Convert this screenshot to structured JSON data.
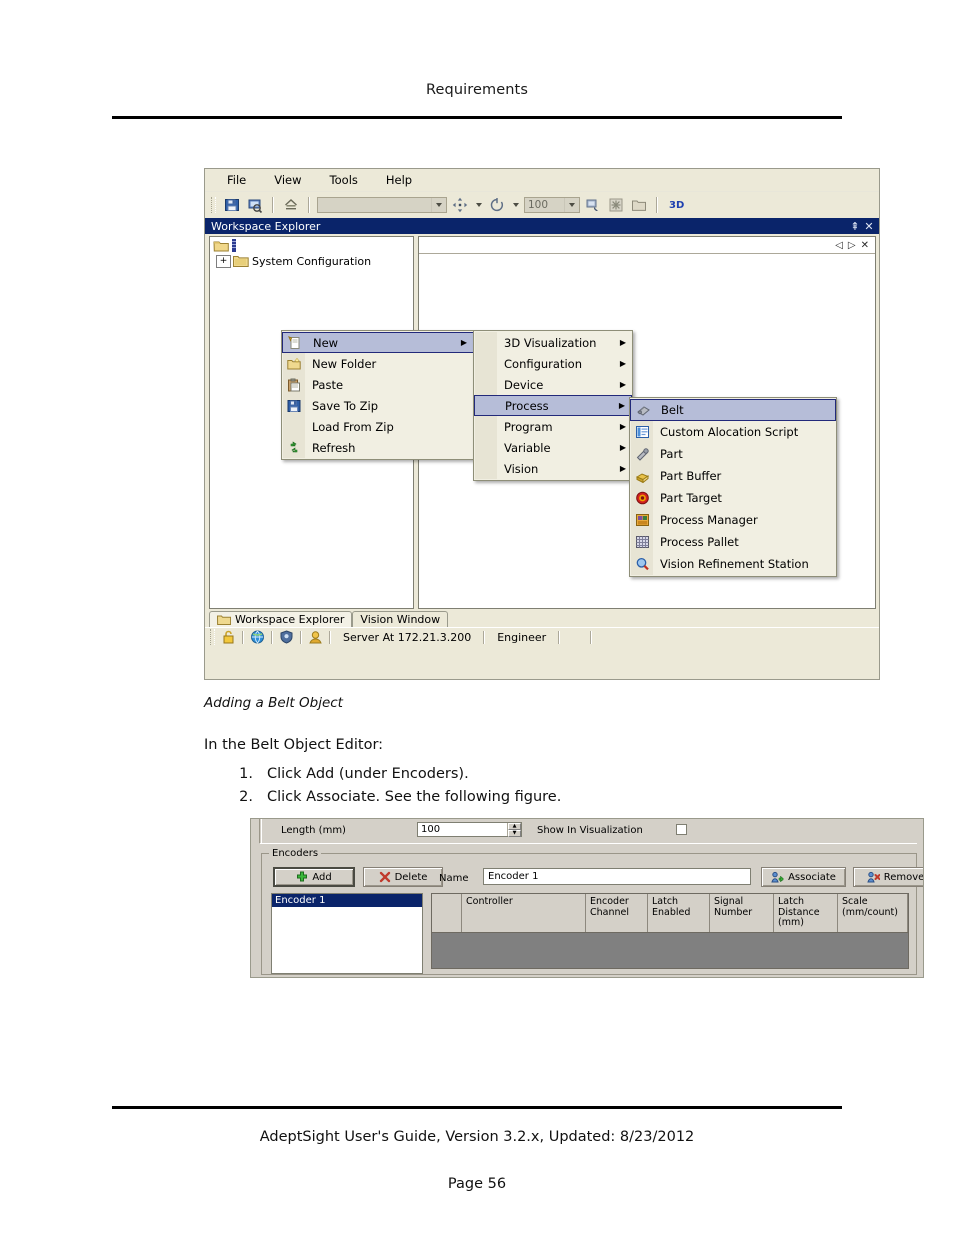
{
  "document": {
    "header_title": "Requirements",
    "footer_line": "AdeptSight User's Guide,  Version 3.2.x, Updated: 8/23/2012",
    "footer_page": "Page 56",
    "figure1_caption": "Adding a Belt Object",
    "intro": "In the Belt Object Editor:",
    "steps": [
      {
        "num": "1.",
        "text": "Click Add (under Encoders)."
      },
      {
        "num": "2.",
        "text": "Click Associate. See the following figure."
      }
    ]
  },
  "app": {
    "menubar": [
      "File",
      "View",
      "Tools",
      "Help"
    ],
    "toolbar": {
      "combo_value": "",
      "zoom_value": "100",
      "button_3d": "3D",
      "icons": [
        "save-icon",
        "print-preview-icon",
        "home-icon",
        "move-tool-icon",
        "rotate-tool-icon",
        "calibrate-icon",
        "snowflake-icon",
        "folder-icon"
      ]
    },
    "panel": {
      "title": "Workspace Explorer",
      "pin_icon": "pin-icon",
      "close_icon": "close-icon"
    },
    "doc_area": {
      "prev_icon": "chevron-left-icon",
      "next_icon": "chevron-right-icon",
      "close_icon": "close-icon"
    },
    "tree": {
      "root_label": "",
      "items": [
        {
          "label": "System Configuration",
          "expander": "+"
        }
      ]
    },
    "bottom_tabs": [
      {
        "label": "Workspace Explorer",
        "selected": true
      },
      {
        "label": "Vision Window",
        "selected": false
      }
    ],
    "statusbar": {
      "server": "Server At 172.21.3.200",
      "user": "Engineer",
      "icons": [
        "lock-icon",
        "globe-icon",
        "shield-icon",
        "user-icon"
      ]
    },
    "context_menu": {
      "items": [
        {
          "label": "New",
          "icon": "new-document-icon",
          "submenu": true,
          "selected": true
        },
        {
          "label": "New Folder",
          "icon": "new-folder-icon",
          "submenu": false,
          "selected": false
        },
        {
          "label": "Paste",
          "icon": "paste-icon",
          "submenu": false,
          "selected": false
        },
        {
          "label": "Save To Zip",
          "icon": "save-icon",
          "submenu": false,
          "selected": false
        },
        {
          "label": "Load From Zip",
          "icon": "",
          "submenu": false,
          "selected": false
        },
        {
          "label": "Refresh",
          "icon": "refresh-icon",
          "submenu": false,
          "selected": false
        }
      ]
    },
    "new_submenu": {
      "items": [
        {
          "label": "3D Visualization",
          "submenu": true,
          "selected": false
        },
        {
          "label": "Configuration",
          "submenu": true,
          "selected": false
        },
        {
          "label": "Device",
          "submenu": true,
          "selected": false
        },
        {
          "label": "Process",
          "submenu": true,
          "selected": true
        },
        {
          "label": "Program",
          "submenu": true,
          "selected": false
        },
        {
          "label": "Variable",
          "submenu": true,
          "selected": false
        },
        {
          "label": "Vision",
          "submenu": true,
          "selected": false
        }
      ]
    },
    "process_submenu": {
      "items": [
        {
          "label": "Belt",
          "icon": "belt-icon",
          "selected": true
        },
        {
          "label": "Custom Alocation Script",
          "icon": "script-icon",
          "selected": false
        },
        {
          "label": "Part",
          "icon": "part-icon",
          "selected": false
        },
        {
          "label": "Part Buffer",
          "icon": "part-buffer-icon",
          "selected": false
        },
        {
          "label": "Part Target",
          "icon": "part-target-icon",
          "selected": false
        },
        {
          "label": "Process Manager",
          "icon": "process-manager-icon",
          "selected": false
        },
        {
          "label": "Process Pallet",
          "icon": "process-pallet-icon",
          "selected": false
        },
        {
          "label": "Vision Refinement Station",
          "icon": "magnifier-icon",
          "selected": false
        }
      ]
    }
  },
  "belt_editor": {
    "length_label": "Length (mm)",
    "length_value": "100",
    "show_in_visualization_label": "Show In Visualization",
    "show_in_visualization_checked": false,
    "encoders_group_label": "Encoders",
    "add_button": "Add",
    "delete_button": "Delete",
    "name_label": "Name",
    "name_value": "Encoder 1",
    "associate_button": "Associate",
    "remove_button": "Remove",
    "encoder_list": [
      "Encoder 1"
    ],
    "encoder_list_selected": "Encoder 1",
    "grid_columns": [
      "",
      "Controller",
      "Encoder Channel",
      "Latch Enabled",
      "Signal Number",
      "Latch Distance (mm)",
      "Scale (mm/count)"
    ],
    "grid_rows": []
  },
  "colors": {
    "titlebar_blue": "#0a246a",
    "face": "#ece9d8",
    "dialog_face": "#d4d0c8",
    "menu_face": "#f1efe2",
    "highlight": "#b6bdd8",
    "highlight_border": "#22297a",
    "grid_empty": "#808080",
    "accent_3d": "#1d3fb0"
  }
}
